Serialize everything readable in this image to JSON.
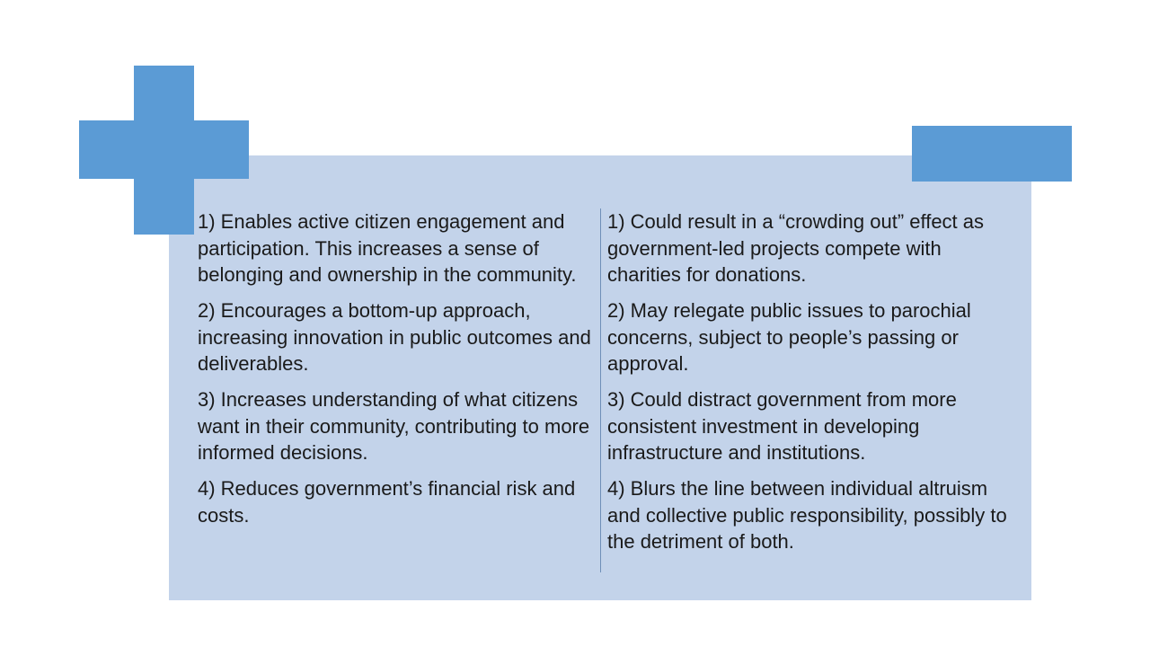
{
  "colors": {
    "accent": "#5b9bd5",
    "panel": "#c3d3ea",
    "text": "#1a1a1a"
  },
  "icons": {
    "plus": "plus-icon",
    "minus": "minus-icon"
  },
  "advantages": [
    "1) Enables active citizen engagement and participation. This increases a sense of belonging and ownership in the community.",
    "2) Encourages a bottom-up approach, increasing innovation in public outcomes and deliverables.",
    "3) Increases understanding of what citizens want in their community, contributing to more informed decisions.",
    "4) Reduces government’s financial risk and costs."
  ],
  "disadvantages": [
    "1) Could result in a “crowding out” effect as government-led projects compete with charities for donations.",
    "2) May relegate public issues to parochial concerns, subject to people’s passing or approval.",
    "3) Could distract government from more consistent investment in developing infrastructure and institutions.",
    "4) Blurs the line between individual altruism and collective public responsibility, possibly to the detriment of both."
  ]
}
